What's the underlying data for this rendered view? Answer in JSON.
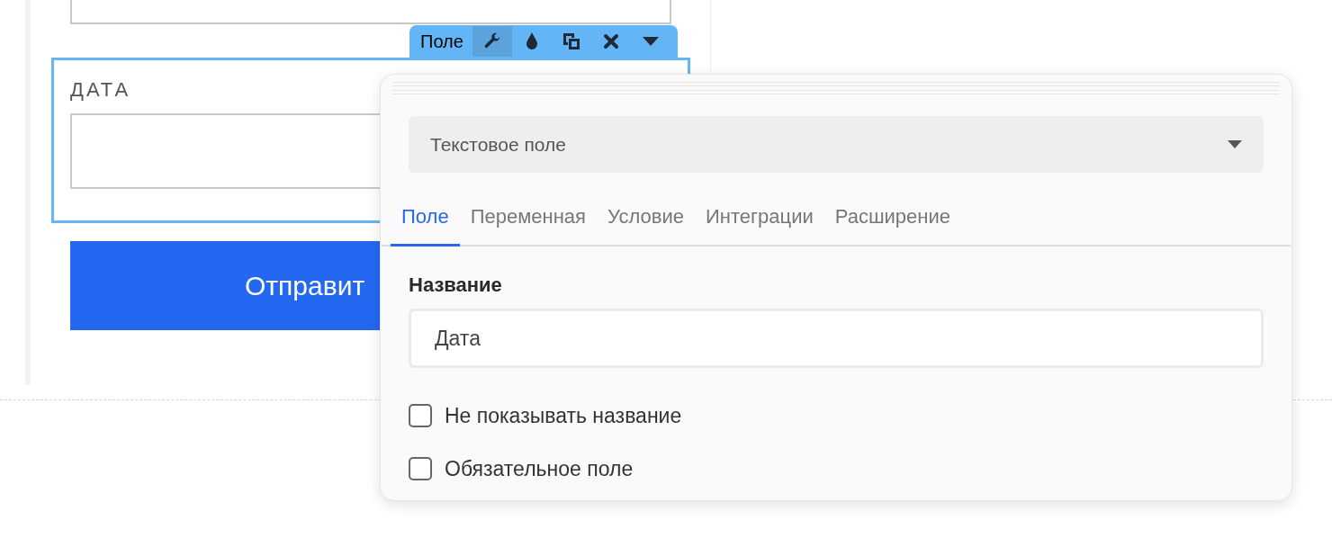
{
  "toolbar": {
    "label": "Поле",
    "tools": [
      {
        "kind": "settings",
        "selected": true
      },
      {
        "kind": "style",
        "selected": false
      },
      {
        "kind": "duplicate",
        "selected": false
      },
      {
        "kind": "delete",
        "selected": false
      },
      {
        "kind": "more",
        "selected": false
      }
    ]
  },
  "field": {
    "label": "ДАТА"
  },
  "submit_button": {
    "label": "Отправит"
  },
  "panel": {
    "type_select": {
      "value": "Текстовое поле"
    },
    "tabs": [
      {
        "label": "Поле",
        "selected": true
      },
      {
        "label": "Переменная",
        "selected": false
      },
      {
        "label": "Условие",
        "selected": false
      },
      {
        "label": "Интеграции",
        "selected": false
      },
      {
        "label": "Расширение",
        "selected": false
      }
    ],
    "name_label": "Название",
    "name_input": {
      "value": "Дата"
    },
    "checkboxes": [
      {
        "label": "Не показывать название",
        "checked": false
      },
      {
        "label": "Обязательное поле",
        "checked": false
      }
    ]
  }
}
